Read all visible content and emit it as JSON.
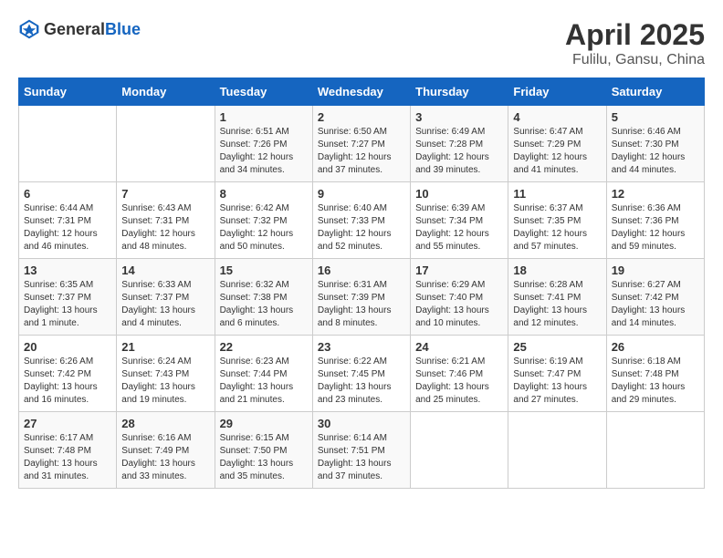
{
  "header": {
    "logo_general": "General",
    "logo_blue": "Blue",
    "month": "April 2025",
    "location": "Fulilu, Gansu, China"
  },
  "weekdays": [
    "Sunday",
    "Monday",
    "Tuesday",
    "Wednesday",
    "Thursday",
    "Friday",
    "Saturday"
  ],
  "weeks": [
    [
      {
        "day": null,
        "content": null
      },
      {
        "day": null,
        "content": null
      },
      {
        "day": "1",
        "content": "Sunrise: 6:51 AM\nSunset: 7:26 PM\nDaylight: 12 hours and 34 minutes."
      },
      {
        "day": "2",
        "content": "Sunrise: 6:50 AM\nSunset: 7:27 PM\nDaylight: 12 hours and 37 minutes."
      },
      {
        "day": "3",
        "content": "Sunrise: 6:49 AM\nSunset: 7:28 PM\nDaylight: 12 hours and 39 minutes."
      },
      {
        "day": "4",
        "content": "Sunrise: 6:47 AM\nSunset: 7:29 PM\nDaylight: 12 hours and 41 minutes."
      },
      {
        "day": "5",
        "content": "Sunrise: 6:46 AM\nSunset: 7:30 PM\nDaylight: 12 hours and 44 minutes."
      }
    ],
    [
      {
        "day": "6",
        "content": "Sunrise: 6:44 AM\nSunset: 7:31 PM\nDaylight: 12 hours and 46 minutes."
      },
      {
        "day": "7",
        "content": "Sunrise: 6:43 AM\nSunset: 7:31 PM\nDaylight: 12 hours and 48 minutes."
      },
      {
        "day": "8",
        "content": "Sunrise: 6:42 AM\nSunset: 7:32 PM\nDaylight: 12 hours and 50 minutes."
      },
      {
        "day": "9",
        "content": "Sunrise: 6:40 AM\nSunset: 7:33 PM\nDaylight: 12 hours and 52 minutes."
      },
      {
        "day": "10",
        "content": "Sunrise: 6:39 AM\nSunset: 7:34 PM\nDaylight: 12 hours and 55 minutes."
      },
      {
        "day": "11",
        "content": "Sunrise: 6:37 AM\nSunset: 7:35 PM\nDaylight: 12 hours and 57 minutes."
      },
      {
        "day": "12",
        "content": "Sunrise: 6:36 AM\nSunset: 7:36 PM\nDaylight: 12 hours and 59 minutes."
      }
    ],
    [
      {
        "day": "13",
        "content": "Sunrise: 6:35 AM\nSunset: 7:37 PM\nDaylight: 13 hours and 1 minute."
      },
      {
        "day": "14",
        "content": "Sunrise: 6:33 AM\nSunset: 7:37 PM\nDaylight: 13 hours and 4 minutes."
      },
      {
        "day": "15",
        "content": "Sunrise: 6:32 AM\nSunset: 7:38 PM\nDaylight: 13 hours and 6 minutes."
      },
      {
        "day": "16",
        "content": "Sunrise: 6:31 AM\nSunset: 7:39 PM\nDaylight: 13 hours and 8 minutes."
      },
      {
        "day": "17",
        "content": "Sunrise: 6:29 AM\nSunset: 7:40 PM\nDaylight: 13 hours and 10 minutes."
      },
      {
        "day": "18",
        "content": "Sunrise: 6:28 AM\nSunset: 7:41 PM\nDaylight: 13 hours and 12 minutes."
      },
      {
        "day": "19",
        "content": "Sunrise: 6:27 AM\nSunset: 7:42 PM\nDaylight: 13 hours and 14 minutes."
      }
    ],
    [
      {
        "day": "20",
        "content": "Sunrise: 6:26 AM\nSunset: 7:42 PM\nDaylight: 13 hours and 16 minutes."
      },
      {
        "day": "21",
        "content": "Sunrise: 6:24 AM\nSunset: 7:43 PM\nDaylight: 13 hours and 19 minutes."
      },
      {
        "day": "22",
        "content": "Sunrise: 6:23 AM\nSunset: 7:44 PM\nDaylight: 13 hours and 21 minutes."
      },
      {
        "day": "23",
        "content": "Sunrise: 6:22 AM\nSunset: 7:45 PM\nDaylight: 13 hours and 23 minutes."
      },
      {
        "day": "24",
        "content": "Sunrise: 6:21 AM\nSunset: 7:46 PM\nDaylight: 13 hours and 25 minutes."
      },
      {
        "day": "25",
        "content": "Sunrise: 6:19 AM\nSunset: 7:47 PM\nDaylight: 13 hours and 27 minutes."
      },
      {
        "day": "26",
        "content": "Sunrise: 6:18 AM\nSunset: 7:48 PM\nDaylight: 13 hours and 29 minutes."
      }
    ],
    [
      {
        "day": "27",
        "content": "Sunrise: 6:17 AM\nSunset: 7:48 PM\nDaylight: 13 hours and 31 minutes."
      },
      {
        "day": "28",
        "content": "Sunrise: 6:16 AM\nSunset: 7:49 PM\nDaylight: 13 hours and 33 minutes."
      },
      {
        "day": "29",
        "content": "Sunrise: 6:15 AM\nSunset: 7:50 PM\nDaylight: 13 hours and 35 minutes."
      },
      {
        "day": "30",
        "content": "Sunrise: 6:14 AM\nSunset: 7:51 PM\nDaylight: 13 hours and 37 minutes."
      },
      {
        "day": null,
        "content": null
      },
      {
        "day": null,
        "content": null
      },
      {
        "day": null,
        "content": null
      }
    ]
  ]
}
